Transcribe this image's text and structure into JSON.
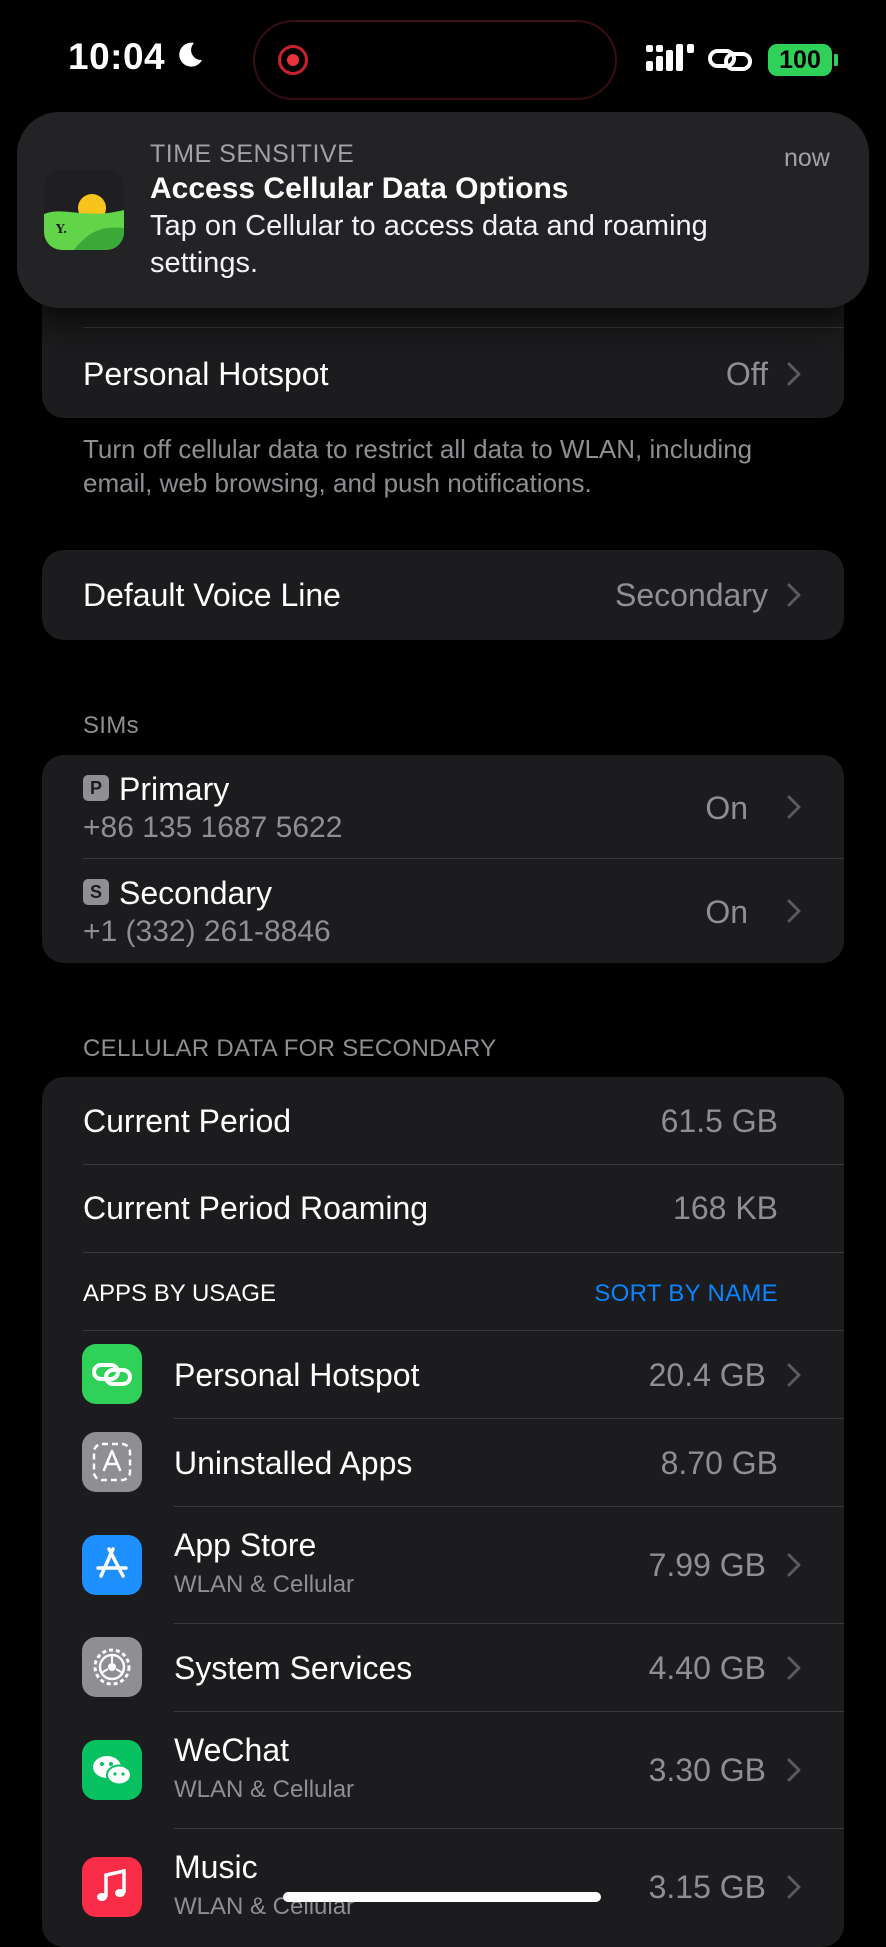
{
  "status_bar": {
    "time": "10:04",
    "battery": "100"
  },
  "notification": {
    "kicker": "TIME SENSITIVE",
    "time": "now",
    "title": "Access Cellular Data Options",
    "body": "Tap on Cellular to access data and roaming settings."
  },
  "hotspot_row": {
    "label": "Personal Hotspot",
    "value": "Off"
  },
  "cellular_footer": "Turn off cellular data to restrict all data to WLAN, including email, web browsing, and push notifications.",
  "voice_line": {
    "label": "Default Voice Line",
    "value": "Secondary"
  },
  "sims": {
    "header": "SIMs",
    "items": [
      {
        "badge": "P",
        "name": "Primary",
        "number": "+86 135 1687 5622",
        "value": "On"
      },
      {
        "badge": "S",
        "name": "Secondary",
        "number": "+1 (332) 261-8846",
        "value": "On"
      }
    ]
  },
  "cellular_data": {
    "header": "CELLULAR DATA FOR SECONDARY",
    "current_period": {
      "label": "Current Period",
      "value": "61.5 GB"
    },
    "roaming": {
      "label": "Current Period Roaming",
      "value": "168 KB"
    },
    "apps_header": "APPS BY USAGE",
    "sort_label": "SORT BY NAME",
    "apps": [
      {
        "name": "Personal Hotspot",
        "subtitle": "",
        "value": "20.4 GB",
        "icon": "hotspot-icon"
      },
      {
        "name": "Uninstalled Apps",
        "subtitle": "",
        "value": "8.70 GB",
        "icon": "uninstalled-apps-icon"
      },
      {
        "name": "App Store",
        "subtitle": "WLAN & Cellular",
        "value": "7.99 GB",
        "icon": "app-store-icon"
      },
      {
        "name": "System Services",
        "subtitle": "",
        "value": "4.40 GB",
        "icon": "gear-icon"
      },
      {
        "name": "WeChat",
        "subtitle": "WLAN & Cellular",
        "value": "3.30 GB",
        "icon": "wechat-icon"
      },
      {
        "name": "Music",
        "subtitle": "WLAN & Cellular",
        "value": "3.15 GB",
        "icon": "music-icon"
      }
    ]
  },
  "colors": {
    "background": "#000000",
    "group": "#1c1c1e",
    "accent": "#0a84ff",
    "battery": "#30d158",
    "hotspot_icon": "#30d158",
    "app_store_icon": "#1e8fff",
    "wechat_icon": "#07c160",
    "music_icon": "#fa2d48"
  }
}
